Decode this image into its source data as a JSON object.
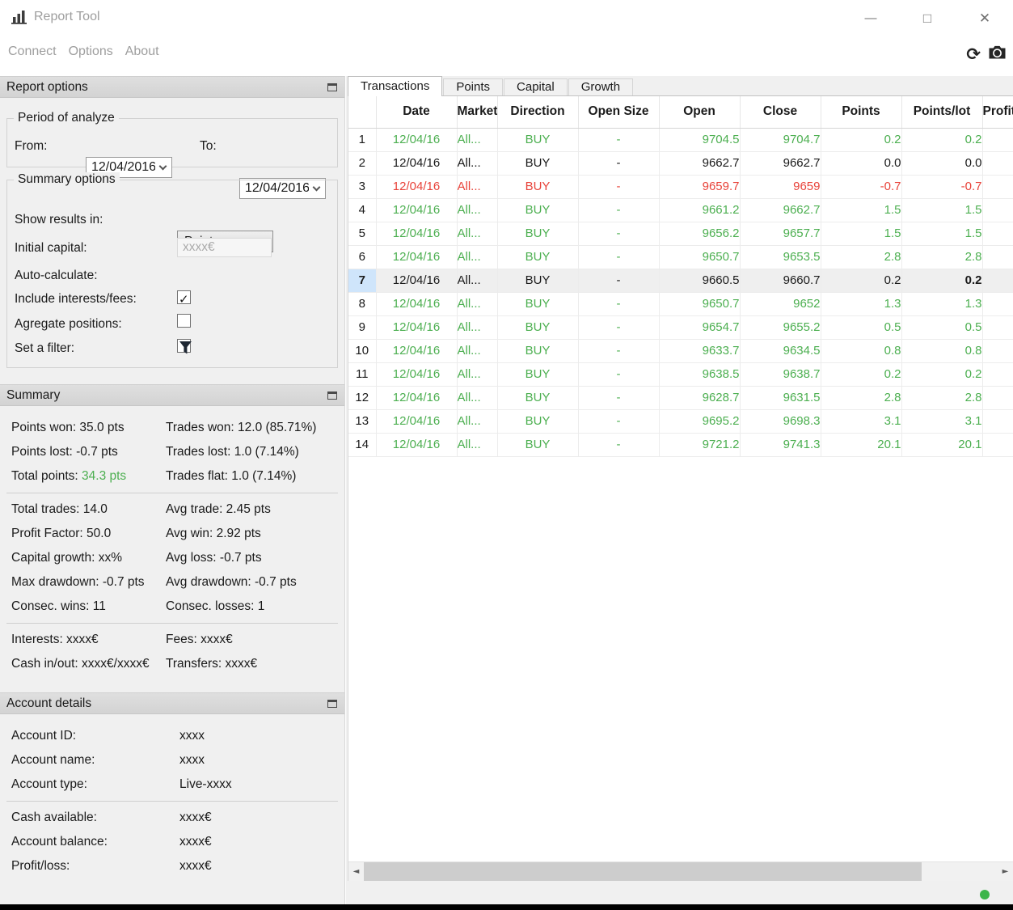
{
  "window": {
    "title": "Report Tool",
    "minimize_glyph": "—",
    "maximize_glyph": "□",
    "close_glyph": "✕"
  },
  "menu": {
    "items": [
      {
        "label": "Connect"
      },
      {
        "label": "Options"
      },
      {
        "label": "About"
      }
    ]
  },
  "icons": {
    "check": "✓",
    "refresh": "⟳",
    "scroll_left": "◄",
    "scroll_right": "►"
  },
  "report_options": {
    "title": "Report options",
    "period": {
      "legend": "Period of analyze",
      "from_label": "From:",
      "from_value": "12/04/2016",
      "to_label": "To:",
      "to_value": "12/04/2016"
    },
    "summary_options": {
      "legend": "Summary options",
      "show_results_label": "Show results in:",
      "show_results_value": "Points",
      "initial_capital_label": "Initial capital:",
      "initial_capital_value": "xxxx€",
      "auto_calculate_label": "Auto-calculate:",
      "auto_calculate_checked": true,
      "include_fees_label": "Include interests/fees:",
      "include_fees_checked": false,
      "agregate_label": "Agregate positions:",
      "agregate_checked": false,
      "filter_label": "Set a filter:"
    }
  },
  "summary": {
    "title": "Summary",
    "block1": [
      {
        "left": "Points won: 35.0 pts",
        "right": "Trades won: 12.0 (85.71%)"
      },
      {
        "left": "Points lost: -0.7 pts",
        "right": "Trades lost: 1.0 (7.14%)"
      }
    ],
    "total_points_label": "Total points:",
    "total_points_value": "34.3 pts",
    "total_points_right": "Trades flat: 1.0 (7.14%)",
    "block2": [
      {
        "left": "Total trades: 14.0",
        "right": "Avg trade: 2.45 pts"
      },
      {
        "left": "Profit Factor: 50.0",
        "right": "Avg win: 2.92 pts"
      },
      {
        "left": "Capital growth: xx%",
        "right": "Avg loss: -0.7 pts"
      },
      {
        "left": "Max drawdown: -0.7 pts",
        "right": "Avg drawdown: -0.7 pts"
      },
      {
        "left": "Consec. wins: 11",
        "right": "Consec. losses: 1"
      }
    ],
    "block3": [
      {
        "left": "Interests: xxxx€",
        "right": "Fees: xxxx€"
      },
      {
        "left": "Cash in/out: xxxx€/xxxx€",
        "right": "Transfers: xxxx€"
      }
    ]
  },
  "account": {
    "title": "Account details",
    "block1": [
      {
        "label": "Account ID:",
        "value": "xxxx"
      },
      {
        "label": "Account name:",
        "value": "xxxx"
      },
      {
        "label": "Account type:",
        "value": "Live-xxxx"
      }
    ],
    "block2": [
      {
        "label": "Cash available:",
        "value": "xxxx€"
      },
      {
        "label": "Account balance:",
        "value": "xxxx€"
      },
      {
        "label": "Profit/loss:",
        "value": "xxxx€"
      }
    ]
  },
  "tabs": [
    {
      "label": "Transactions",
      "active": true
    },
    {
      "label": "Points"
    },
    {
      "label": "Capital"
    },
    {
      "label": "Growth"
    }
  ],
  "table": {
    "headers": {
      "date": "Date",
      "market": "Market",
      "direction": "Direction",
      "open_size": "Open Size",
      "open": "Open",
      "close": "Close",
      "points": "Points",
      "points_lot": "Points/lot",
      "profit": "Profit"
    },
    "rows": [
      {
        "num": "1",
        "date": "12/04/16",
        "market": "All...",
        "direction": "BUY",
        "open_size": "-",
        "open": "9704.5",
        "close": "9704.7",
        "points": "0.2",
        "points_lot": "0.2",
        "color": "green"
      },
      {
        "num": "2",
        "date": "12/04/16",
        "market": "All...",
        "direction": "BUY",
        "open_size": "-",
        "open": "9662.7",
        "close": "9662.7",
        "points": "0.0",
        "points_lot": "0.0",
        "color": "black"
      },
      {
        "num": "3",
        "date": "12/04/16",
        "market": "All...",
        "direction": "BUY",
        "open_size": "-",
        "open": "9659.7",
        "close": "9659",
        "points": "-0.7",
        "points_lot": "-0.7",
        "color": "red"
      },
      {
        "num": "4",
        "date": "12/04/16",
        "market": "All...",
        "direction": "BUY",
        "open_size": "-",
        "open": "9661.2",
        "close": "9662.7",
        "points": "1.5",
        "points_lot": "1.5",
        "color": "green"
      },
      {
        "num": "5",
        "date": "12/04/16",
        "market": "All...",
        "direction": "BUY",
        "open_size": "-",
        "open": "9656.2",
        "close": "9657.7",
        "points": "1.5",
        "points_lot": "1.5",
        "color": "green"
      },
      {
        "num": "6",
        "date": "12/04/16",
        "market": "All...",
        "direction": "BUY",
        "open_size": "-",
        "open": "9650.7",
        "close": "9653.5",
        "points": "2.8",
        "points_lot": "2.8",
        "color": "green"
      },
      {
        "num": "7",
        "date": "12/04/16",
        "market": "All...",
        "direction": "BUY",
        "open_size": "-",
        "open": "9660.5",
        "close": "9660.7",
        "points": "0.2",
        "points_lot": "0.2",
        "color": "black",
        "selected": true
      },
      {
        "num": "8",
        "date": "12/04/16",
        "market": "All...",
        "direction": "BUY",
        "open_size": "-",
        "open": "9650.7",
        "close": "9652",
        "points": "1.3",
        "points_lot": "1.3",
        "color": "green"
      },
      {
        "num": "9",
        "date": "12/04/16",
        "market": "All...",
        "direction": "BUY",
        "open_size": "-",
        "open": "9654.7",
        "close": "9655.2",
        "points": "0.5",
        "points_lot": "0.5",
        "color": "green"
      },
      {
        "num": "10",
        "date": "12/04/16",
        "market": "All...",
        "direction": "BUY",
        "open_size": "-",
        "open": "9633.7",
        "close": "9634.5",
        "points": "0.8",
        "points_lot": "0.8",
        "color": "green"
      },
      {
        "num": "11",
        "date": "12/04/16",
        "market": "All...",
        "direction": "BUY",
        "open_size": "-",
        "open": "9638.5",
        "close": "9638.7",
        "points": "0.2",
        "points_lot": "0.2",
        "color": "green"
      },
      {
        "num": "12",
        "date": "12/04/16",
        "market": "All...",
        "direction": "BUY",
        "open_size": "-",
        "open": "9628.7",
        "close": "9631.5",
        "points": "2.8",
        "points_lot": "2.8",
        "color": "green"
      },
      {
        "num": "13",
        "date": "12/04/16",
        "market": "All...",
        "direction": "BUY",
        "open_size": "-",
        "open": "9695.2",
        "close": "9698.3",
        "points": "3.1",
        "points_lot": "3.1",
        "color": "green"
      },
      {
        "num": "14",
        "date": "12/04/16",
        "market": "All...",
        "direction": "BUY",
        "open_size": "-",
        "open": "9721.2",
        "close": "9741.3",
        "points": "20.1",
        "points_lot": "20.1",
        "color": "green"
      }
    ]
  },
  "colors": {
    "profit_green": "#4caf50",
    "loss_red": "#e8433a",
    "flat_black": "#1a1a1a",
    "selected_row_bg": "#efefef",
    "selected_rownum_bg": "#cfe5fb",
    "status_dot_green": "#3cb54a"
  }
}
